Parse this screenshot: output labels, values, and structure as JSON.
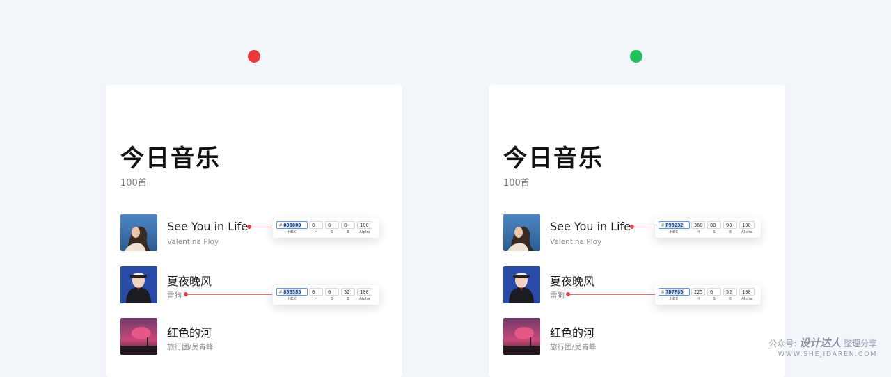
{
  "status_dots": {
    "bad_color": "#e83a3a",
    "good_color": "#22c05a"
  },
  "cards": [
    {
      "title": "今日音乐",
      "count": "100首",
      "tracks": [
        {
          "name": "See You in Life",
          "artist": "Valentina Ploy"
        },
        {
          "name": "夏夜晚风",
          "artist": "雷狗"
        },
        {
          "name": "红色的河",
          "artist": "旅行团/吴青峰"
        }
      ],
      "pickers": [
        {
          "hash": "#",
          "hex": "000000",
          "h": "0",
          "s": "0",
          "b": "0",
          "alpha": "100",
          "swatch": "#000000"
        },
        {
          "hash": "#",
          "hex": "858585",
          "h": "0",
          "s": "0",
          "b": "52",
          "alpha": "100",
          "swatch": "#858585"
        }
      ]
    },
    {
      "title": "今日音乐",
      "count": "100首",
      "tracks": [
        {
          "name": "See You in Life",
          "artist": "Valentina Ploy"
        },
        {
          "name": "夏夜晚风",
          "artist": "雷狗"
        },
        {
          "name": "红色的河",
          "artist": "旅行团/吴青峰"
        }
      ],
      "pickers": [
        {
          "hash": "#",
          "hex": "F93232",
          "h": "360",
          "s": "80",
          "b": "98",
          "alpha": "100",
          "swatch": "#F93232"
        },
        {
          "hash": "#",
          "hex": "7D7F85",
          "h": "225",
          "s": "6",
          "b": "52",
          "alpha": "100",
          "swatch": "#7D7F85"
        }
      ]
    }
  ],
  "picker_labels": {
    "hex": "HEX",
    "h": "H",
    "s": "S",
    "b": "B",
    "alpha": "Alpha"
  },
  "watermark": {
    "prefix": "公众号:",
    "brand": "设计达人",
    "suffix": "整理分享",
    "url": "WWW.SHEJIDAREN.COM"
  }
}
